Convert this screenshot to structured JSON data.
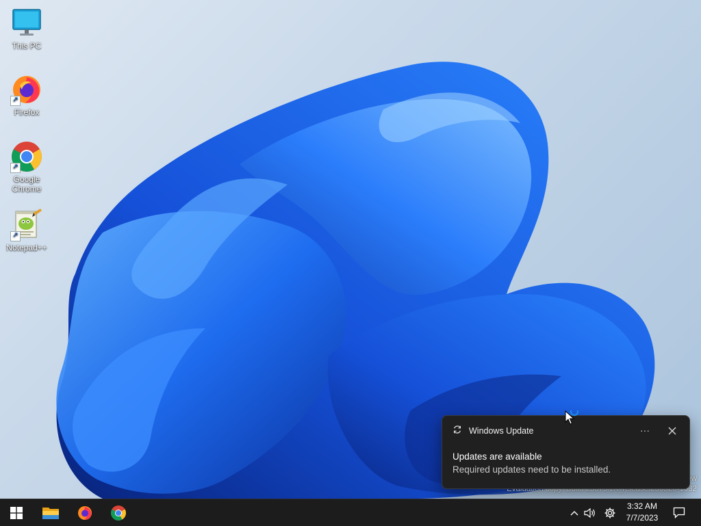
{
  "desktop": {
    "icons": [
      {
        "label": "This PC",
        "icon": "monitor-icon"
      },
      {
        "label": "Firefox",
        "icon": "firefox-icon"
      },
      {
        "label_line1": "Google",
        "label_line2": "Chrome",
        "icon": "chrome-icon"
      },
      {
        "label": "Notepad++",
        "icon": "notepadpp-icon"
      }
    ],
    "watermark_line1": "ew",
    "watermark_line2": "Evaluation copy. Build 25375.zn_release.230520-1632"
  },
  "notification": {
    "app_name": "Windows Update",
    "app_icon": "refresh-icon",
    "more_label": "···",
    "title": "Updates are available",
    "body": "Required updates need to be installed."
  },
  "taskbar": {
    "pinned": [
      {
        "name": "start",
        "icon": "windows-logo-icon"
      },
      {
        "name": "file-explorer",
        "icon": "folder-icon"
      },
      {
        "name": "firefox",
        "icon": "firefox-icon"
      },
      {
        "name": "chrome",
        "icon": "chrome-icon"
      }
    ],
    "clock": {
      "time": "3:32 AM",
      "date": "7/7/2023"
    }
  },
  "colors": {
    "taskbar_bg": "#1c1c1c",
    "toast_bg": "#202020",
    "wallpaper_blue": "#1e63e0"
  }
}
